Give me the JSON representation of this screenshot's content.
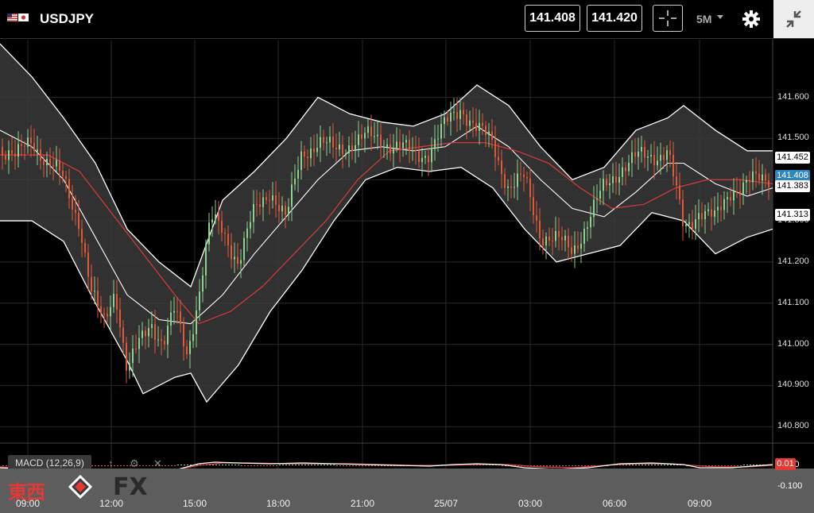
{
  "header": {
    "symbol": "USDJPY",
    "flags": [
      "us-flag-icon",
      "japan-flag-icon"
    ],
    "bid": "141.408",
    "ask": "141.420",
    "timeframe": "5M",
    "tools": [
      "crosshair-icon",
      "gear-icon",
      "collapse-icon"
    ]
  },
  "colors": {
    "background": "#000000",
    "bull": "#8fd18f",
    "bear": "#e05a3a",
    "band_fill": "#3a3a3a",
    "ma": "#d83a3a",
    "bollinger": "#ffffff",
    "current_tag": "#2e86c1",
    "macd_tag": "#e53935"
  },
  "chart_data": {
    "type": "candlestick",
    "symbol": "USDJPY",
    "timeframe": "5M",
    "y_ticks": [
      "141.600",
      "141.500",
      "141.400",
      "141.300",
      "141.200",
      "141.100",
      "141.000",
      "140.900",
      "140.800"
    ],
    "ylim": [
      140.76,
      141.74
    ],
    "x_ticks": [
      "09:00",
      "12:00",
      "15:00",
      "18:00",
      "21:00",
      "25/07",
      "03:00",
      "06:00",
      "09:00"
    ],
    "price_tags": [
      {
        "label": "141.452",
        "value": 141.452,
        "style": "white"
      },
      {
        "label": "141.408",
        "value": 141.408,
        "style": "current"
      },
      {
        "label": "141.383",
        "value": 141.383,
        "style": "white"
      },
      {
        "label": "141.313",
        "value": 141.313,
        "style": "white"
      }
    ],
    "close_path": [
      [
        0,
        141.48
      ],
      [
        20,
        141.45
      ],
      [
        40,
        141.5
      ],
      [
        60,
        141.44
      ],
      [
        80,
        141.4
      ],
      [
        100,
        141.3
      ],
      [
        115,
        141.12
      ],
      [
        130,
        141.05
      ],
      [
        145,
        141.14
      ],
      [
        160,
        140.93
      ],
      [
        175,
        141.0
      ],
      [
        190,
        141.06
      ],
      [
        205,
        141.0
      ],
      [
        220,
        141.08
      ],
      [
        235,
        140.98
      ],
      [
        250,
        141.12
      ],
      [
        265,
        141.3
      ],
      [
        280,
        141.28
      ],
      [
        300,
        141.2
      ],
      [
        320,
        141.32
      ],
      [
        340,
        141.38
      ],
      [
        360,
        141.3
      ],
      [
        380,
        141.47
      ],
      [
        400,
        141.49
      ],
      [
        420,
        141.47
      ],
      [
        440,
        141.49
      ],
      [
        460,
        141.5
      ],
      [
        480,
        141.5
      ],
      [
        500,
        141.48
      ],
      [
        520,
        141.46
      ],
      [
        540,
        141.47
      ],
      [
        560,
        141.53
      ],
      [
        580,
        141.58
      ],
      [
        600,
        141.52
      ],
      [
        620,
        141.49
      ],
      [
        640,
        141.38
      ],
      [
        660,
        141.4
      ],
      [
        680,
        141.27
      ],
      [
        700,
        141.25
      ],
      [
        720,
        141.23
      ],
      [
        740,
        141.3
      ],
      [
        760,
        141.38
      ],
      [
        780,
        141.43
      ],
      [
        800,
        141.45
      ],
      [
        820,
        141.46
      ],
      [
        840,
        141.47
      ],
      [
        860,
        141.28
      ],
      [
        880,
        141.33
      ],
      [
        900,
        141.3
      ],
      [
        920,
        141.38
      ],
      [
        940,
        141.39
      ],
      [
        960,
        141.4
      ],
      [
        970,
        141.408
      ]
    ],
    "bollinger": {
      "upper": [
        [
          0,
          141.73
        ],
        [
          40,
          141.65
        ],
        [
          80,
          141.55
        ],
        [
          120,
          141.44
        ],
        [
          160,
          141.28
        ],
        [
          200,
          141.2
        ],
        [
          240,
          141.14
        ],
        [
          280,
          141.35
        ],
        [
          320,
          141.42
        ],
        [
          360,
          141.5
        ],
        [
          400,
          141.6
        ],
        [
          440,
          141.56
        ],
        [
          480,
          141.54
        ],
        [
          520,
          141.53
        ],
        [
          560,
          141.56
        ],
        [
          600,
          141.63
        ],
        [
          640,
          141.58
        ],
        [
          680,
          141.48
        ],
        [
          720,
          141.4
        ],
        [
          760,
          141.43
        ],
        [
          800,
          141.52
        ],
        [
          840,
          141.55
        ],
        [
          860,
          141.58
        ],
        [
          900,
          141.52
        ],
        [
          940,
          141.47
        ],
        [
          972,
          141.47
        ]
      ],
      "middle": [
        [
          0,
          141.52
        ],
        [
          40,
          141.48
        ],
        [
          80,
          141.4
        ],
        [
          120,
          141.26
        ],
        [
          160,
          141.12
        ],
        [
          200,
          141.06
        ],
        [
          240,
          141.05
        ],
        [
          280,
          141.12
        ],
        [
          320,
          141.22
        ],
        [
          360,
          141.31
        ],
        [
          400,
          141.4
        ],
        [
          440,
          141.47
        ],
        [
          480,
          141.48
        ],
        [
          520,
          141.47
        ],
        [
          560,
          141.48
        ],
        [
          600,
          141.53
        ],
        [
          640,
          141.48
        ],
        [
          680,
          141.4
        ],
        [
          720,
          141.33
        ],
        [
          760,
          141.31
        ],
        [
          800,
          141.37
        ],
        [
          840,
          141.44
        ],
        [
          860,
          141.44
        ],
        [
          900,
          141.39
        ],
        [
          940,
          141.36
        ],
        [
          972,
          141.38
        ]
      ],
      "lower": [
        [
          0,
          141.3
        ],
        [
          40,
          141.3
        ],
        [
          80,
          141.25
        ],
        [
          120,
          141.1
        ],
        [
          160,
          140.96
        ],
        [
          180,
          140.88
        ],
        [
          220,
          140.92
        ],
        [
          240,
          140.93
        ],
        [
          260,
          140.86
        ],
        [
          300,
          140.95
        ],
        [
          340,
          141.08
        ],
        [
          380,
          141.18
        ],
        [
          420,
          141.3
        ],
        [
          460,
          141.4
        ],
        [
          500,
          141.43
        ],
        [
          540,
          141.42
        ],
        [
          580,
          141.43
        ],
        [
          620,
          141.38
        ],
        [
          660,
          141.28
        ],
        [
          700,
          141.2
        ],
        [
          740,
          141.22
        ],
        [
          780,
          141.24
        ],
        [
          820,
          141.32
        ],
        [
          860,
          141.3
        ],
        [
          900,
          141.22
        ],
        [
          940,
          141.26
        ],
        [
          972,
          141.28
        ]
      ]
    },
    "moving_average": [
      [
        0,
        141.46
      ],
      [
        60,
        141.46
      ],
      [
        100,
        141.42
      ],
      [
        140,
        141.32
      ],
      [
        180,
        141.22
      ],
      [
        220,
        141.12
      ],
      [
        250,
        141.05
      ],
      [
        290,
        141.08
      ],
      [
        330,
        141.14
      ],
      [
        370,
        141.22
      ],
      [
        410,
        141.3
      ],
      [
        450,
        141.4
      ],
      [
        490,
        141.47
      ],
      [
        530,
        141.48
      ],
      [
        570,
        141.49
      ],
      [
        610,
        141.49
      ],
      [
        650,
        141.47
      ],
      [
        690,
        141.44
      ],
      [
        730,
        141.38
      ],
      [
        770,
        141.33
      ],
      [
        810,
        141.34
      ],
      [
        850,
        141.38
      ],
      [
        890,
        141.4
      ],
      [
        930,
        141.4
      ],
      [
        972,
        141.39
      ]
    ],
    "macd": {
      "label": "MACD (12,26,9)",
      "y_ticks": [
        "0.000",
        "-0.100"
      ],
      "value_tag": "0.01",
      "macd_line": [
        [
          0,
          -0.03
        ],
        [
          60,
          -0.06
        ],
        [
          100,
          -0.09
        ],
        [
          140,
          -0.12
        ],
        [
          180,
          -0.1
        ],
        [
          220,
          -0.06
        ],
        [
          250,
          0.02
        ],
        [
          270,
          0.04
        ],
        [
          300,
          0.03
        ],
        [
          340,
          0.02
        ],
        [
          380,
          0.03
        ],
        [
          420,
          0.02
        ],
        [
          460,
          0.01
        ],
        [
          500,
          0.0
        ],
        [
          540,
          -0.01
        ],
        [
          570,
          0.01
        ],
        [
          600,
          0.02
        ],
        [
          630,
          0.01
        ],
        [
          660,
          -0.03
        ],
        [
          700,
          -0.05
        ],
        [
          740,
          -0.03
        ],
        [
          780,
          0.02
        ],
        [
          820,
          0.03
        ],
        [
          860,
          0.01
        ],
        [
          880,
          -0.03
        ],
        [
          920,
          -0.03
        ],
        [
          972,
          0.01
        ]
      ],
      "signal_line": [
        [
          0,
          -0.02
        ],
        [
          60,
          -0.04
        ],
        [
          100,
          -0.07
        ],
        [
          140,
          -0.1
        ],
        [
          180,
          -0.09
        ],
        [
          220,
          -0.06
        ],
        [
          250,
          0.0
        ],
        [
          280,
          0.03
        ],
        [
          320,
          0.03
        ],
        [
          360,
          0.02
        ],
        [
          400,
          0.02
        ],
        [
          440,
          0.02
        ],
        [
          480,
          0.01
        ],
        [
          520,
          0.0
        ],
        [
          560,
          0.0
        ],
        [
          600,
          0.01
        ],
        [
          640,
          0.01
        ],
        [
          680,
          -0.02
        ],
        [
          720,
          -0.03
        ],
        [
          760,
          0.0
        ],
        [
          800,
          0.02
        ],
        [
          840,
          0.02
        ],
        [
          870,
          0.0
        ],
        [
          900,
          -0.02
        ],
        [
          940,
          -0.02
        ],
        [
          972,
          0.0
        ]
      ]
    }
  },
  "macd_tools": [
    "arrow-up-icon",
    "gear-icon",
    "close-icon"
  ],
  "branding": {
    "text": "東西",
    "suffix": "FX"
  }
}
